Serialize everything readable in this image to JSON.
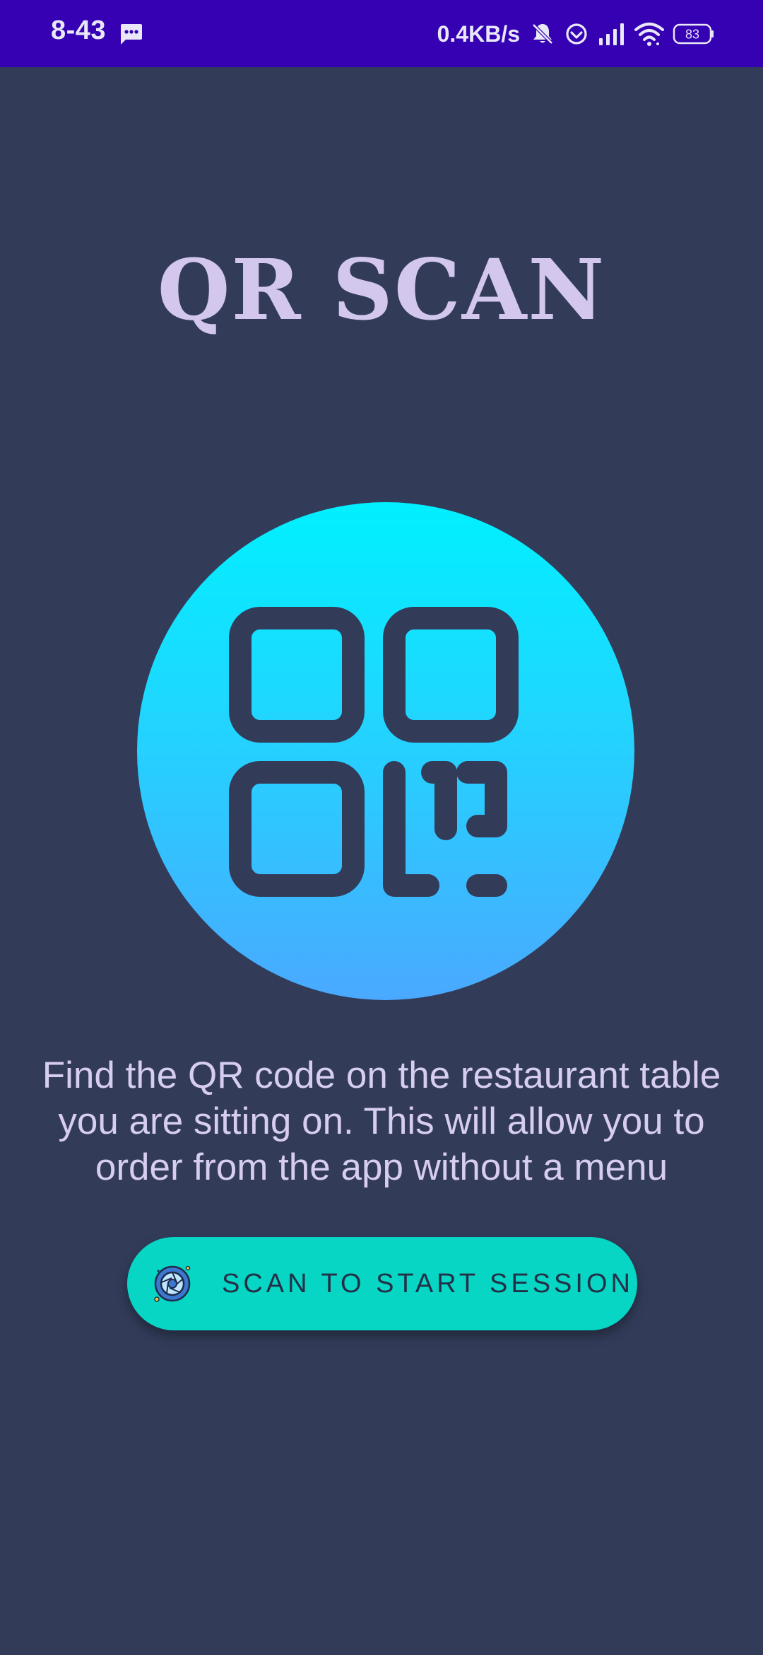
{
  "status_bar": {
    "time": "8-43",
    "network_speed": "0.4KB/s",
    "battery_level": "83",
    "icons": [
      "message-icon",
      "mute-icon",
      "sync-icon",
      "signal-icon",
      "wifi-icon",
      "battery-icon"
    ]
  },
  "main": {
    "title": "QR SCAN",
    "hero_icon": "qr-code-icon",
    "description": "Find the QR code on the restaurant table you are sitting on. This will allow you to order from the app without a menu",
    "scan_button": {
      "label": "SCAN TO START SESSION",
      "icon": "camera-shutter-icon"
    }
  },
  "colors": {
    "status_bar_bg": "#3600B3",
    "page_bg": "#323C59",
    "title_text": "#D3C7EE",
    "button_bg": "#06D6C3",
    "circle_top": "#00F0FF",
    "circle_bottom": "#4AA9FF"
  }
}
